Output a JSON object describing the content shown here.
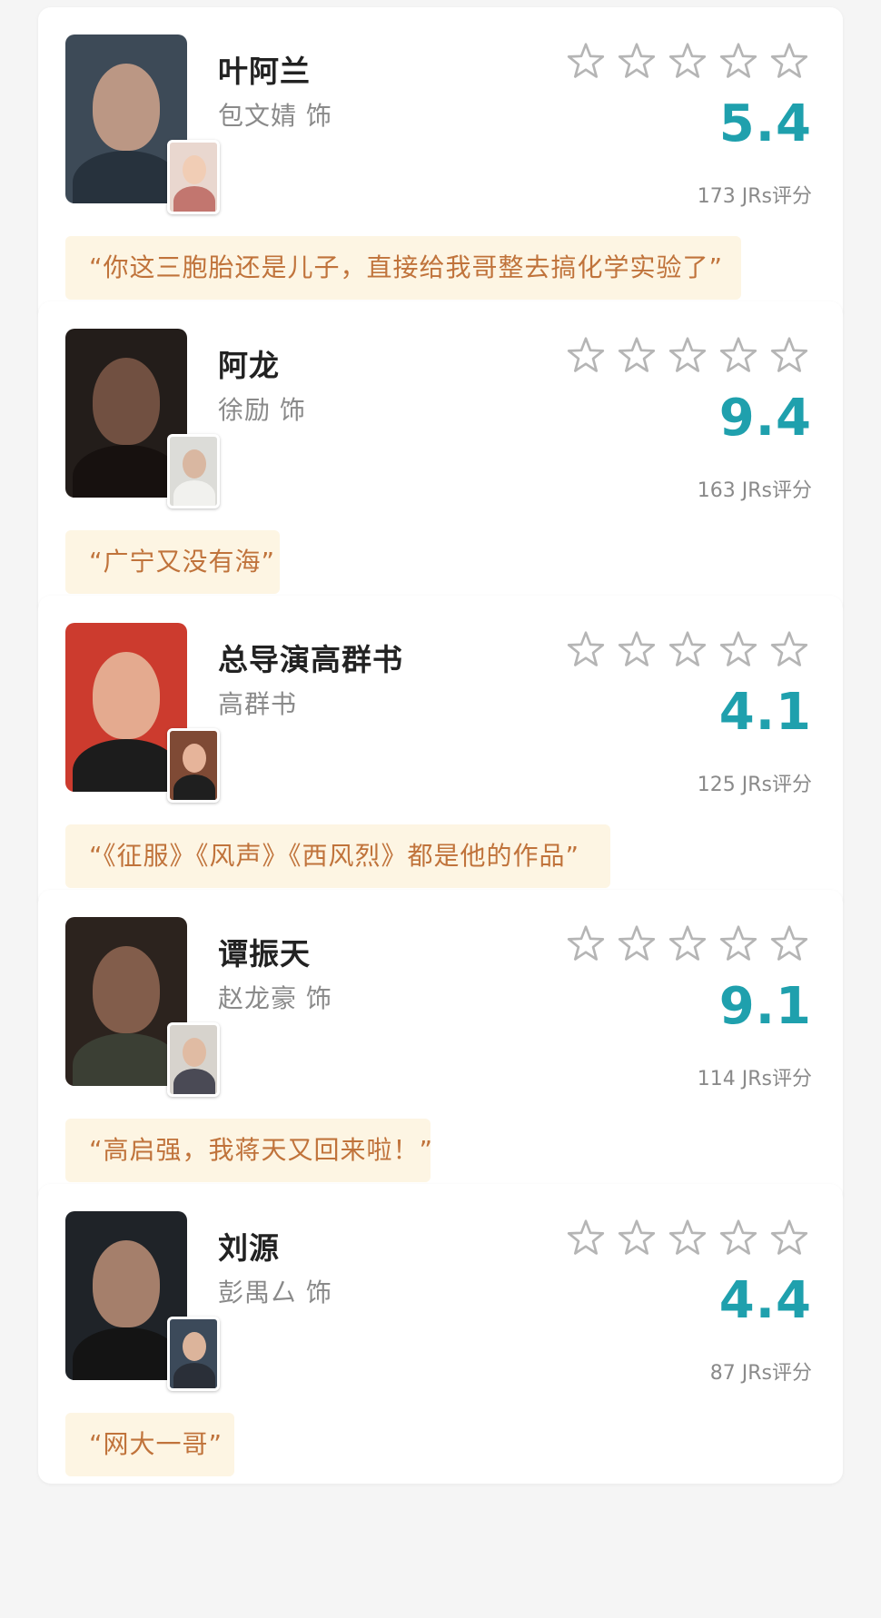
{
  "colors": {
    "page_background": "#f5f5f5",
    "card_background": "#ffffff",
    "score": "#1fa0ad",
    "quote_text": "#c0733b",
    "quote_background": "#fdf5e3",
    "star_outline": "#b5b5b5"
  },
  "star_icon": "star-outline-icon",
  "stars_per_card": 5,
  "cards": [
    {
      "name": "叶阿兰",
      "actor": "包文婧 饰",
      "score": "5.4",
      "count": "173 JRs评分",
      "quote": "“你这三胞胎还是儿子，直接给我哥整去搞化学实验了”",
      "photo": {
        "bg": "#3d4a57",
        "face": "#c9a089",
        "body": "#27323d"
      },
      "thumb": {
        "bg": "#e9d7cf",
        "face": "#f1cdb5",
        "body": "#c2766f"
      }
    },
    {
      "name": "阿龙",
      "actor": "徐励 饰",
      "score": "9.4",
      "count": "163 JRs评分",
      "quote": "“广宁又没有海”",
      "photo": {
        "bg": "#231d1a",
        "face": "#7a5646",
        "body": "#17110f"
      },
      "thumb": {
        "bg": "#dcdcd8",
        "face": "#d9b7a1",
        "body": "#f1f1ee"
      }
    },
    {
      "name": "总导演高群书",
      "actor": "高群书",
      "score": "4.1",
      "count": "125 JRs评分",
      "quote": "“《征服》《风声》《西风烈》都是他的作品”",
      "photo": {
        "bg": "#cc3b2e",
        "face": "#e7b79a",
        "body": "#1c1c1c"
      },
      "thumb": {
        "bg": "#7f4a35",
        "face": "#e6b49a",
        "body": "#1f1f1f"
      }
    },
    {
      "name": "谭振天",
      "actor": "赵龙豪 饰",
      "score": "9.1",
      "count": "114 JRs评分",
      "quote": "“高启强，我蒋天又回来啦！”",
      "photo": {
        "bg": "#2c231e",
        "face": "#8c6450",
        "body": "#3b3f34"
      },
      "thumb": {
        "bg": "#d7d3cd",
        "face": "#e0bba3",
        "body": "#4a4a55"
      }
    },
    {
      "name": "刘源",
      "actor": "彭禺厶 饰",
      "score": "4.4",
      "count": "87 JRs评分",
      "quote": "“网大一哥”",
      "photo": {
        "bg": "#1f2328",
        "face": "#b48972",
        "body": "#141414"
      },
      "thumb": {
        "bg": "#3c4a5a",
        "face": "#dcb49b",
        "body": "#2a2f38"
      }
    }
  ]
}
